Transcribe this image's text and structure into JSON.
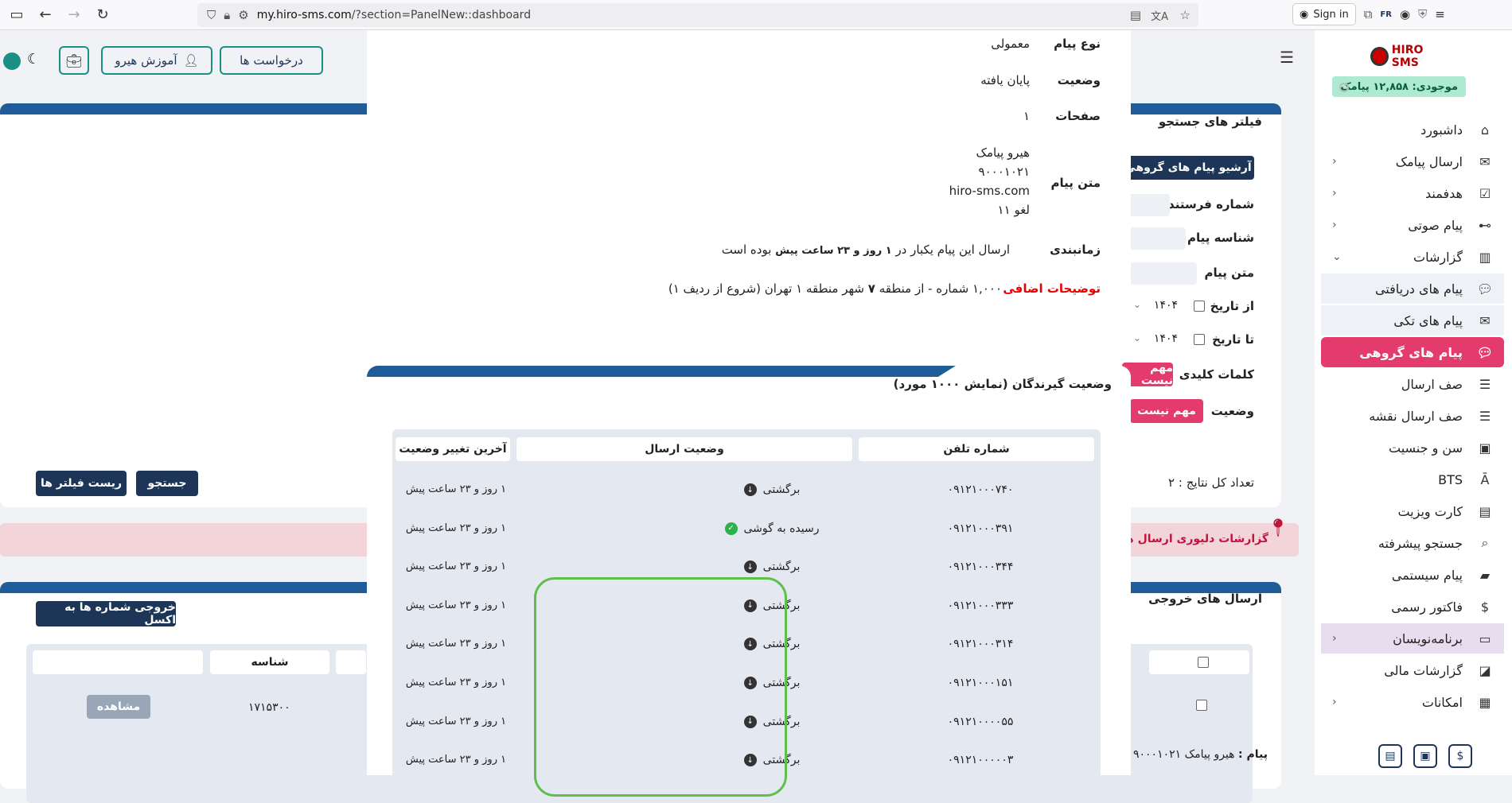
{
  "browser": {
    "url_host": "my.hiro-sms.com",
    "url_path": "/?section=PanelNew::dashboard",
    "signin_label": "Sign in",
    "flag_label": "FR"
  },
  "sidebar": {
    "logo_text": "HIRO SMS",
    "balance": "موجودی: ۱۲,۸۵۸ پیامک",
    "items": [
      {
        "label": "داشبورد",
        "icon": "home-icon"
      },
      {
        "label": "ارسال پیامک",
        "icon": "sms-icon"
      },
      {
        "label": "هدفمند",
        "icon": "target-icon"
      },
      {
        "label": "پیام صوتی",
        "icon": "voicemail-icon"
      },
      {
        "label": "گزارشات",
        "icon": "report-icon"
      },
      {
        "label": "پیام های دریافتی",
        "icon": "chat-icon"
      },
      {
        "label": "پیام های تکی",
        "icon": "sms-icon"
      },
      {
        "label": "پیام های گروهی",
        "icon": "group-chat-icon"
      },
      {
        "label": "صف ارسال",
        "icon": "queue-icon"
      },
      {
        "label": "صف ارسال نقشه",
        "icon": "queue-icon"
      },
      {
        "label": "سن و جنسیت",
        "icon": "id-card-icon"
      },
      {
        "label": "BTS",
        "icon": "antenna-icon"
      },
      {
        "label": "کارت ویزیت",
        "icon": "card-icon"
      },
      {
        "label": "جستجو پیشرفته",
        "icon": "search-icon"
      },
      {
        "label": "پیام سیستمی",
        "icon": "briefcase-icon"
      },
      {
        "label": "فاکتور رسمی",
        "icon": "invoice-icon"
      },
      {
        "label": "برنامه‌نویسان",
        "icon": "code-icon"
      },
      {
        "label": "گزارشات مالی",
        "icon": "chart-icon"
      },
      {
        "label": "امکانات",
        "icon": "tools-icon"
      }
    ]
  },
  "header": {
    "requests": "درخواست ها",
    "education": "آموزش هیرو"
  },
  "filters": {
    "title": "فیلتر های جستجو",
    "archive": "آرشیو پیام های گروهی",
    "sender": "شماره فرستنده",
    "msg_id": "شناسه پیام",
    "msg_text": "متن پیام",
    "from_date": "از تاریخ",
    "to_date": "تا تاریخ",
    "year": "۱۴۰۴",
    "keywords": "کلمات کلیدی",
    "status": "وضعیت",
    "not_important": "مهم نیست",
    "total": "تعداد کل نتایج : ۲",
    "search": "جستجو",
    "reset": "ریست فیلتر ها"
  },
  "alert": "گزارشات دلیوری ارسال ها تا پایا",
  "outbox": {
    "title": "ارسال های خروجی",
    "export": "خروجی شماره ها به اکسل",
    "col_id": "شناسه",
    "row_id": "۱۷۱۵۳۰۰",
    "view": "مشاهده",
    "message_label": "پیام :",
    "message_preview": "هیرو پیامک ۹۰۰۰۱۰۲۱"
  },
  "details": {
    "type_k": "نوع پیام",
    "type_v": "معمولی",
    "status_k": "وضعیت",
    "status_v": "پایان یافته",
    "pages_k": "صفحات",
    "pages_v": "۱",
    "text_k": "متن پیام",
    "text_l1": "هیرو پیامک",
    "text_l2": "۹۰۰۰۱۰۲۱",
    "text_l3": "hiro-sms.com",
    "text_l4": "لغو ۱۱",
    "sched_k": "زمانبندی",
    "sched_v1": "ارسال این پیام یکبار در",
    "sched_v2": "۱ روز و ۲۳ ساعت پیش",
    "sched_v3": "بوده است",
    "extra_k": "توضیحات اضافی",
    "extra_v1": "۱,۰۰۰ شماره - از منطقه",
    "extra_v2": "۷",
    "extra_v3": "شهر منطقه ۱ تهران (شروع از ردیف ۱)"
  },
  "recipients": {
    "title": "وضعیت گیرندگان (نمایش ۱۰۰۰ مورد)",
    "columns": [
      "شماره تلفن",
      "وضعیت ارسال",
      "آخرین تغییر وضعیت"
    ],
    "rows": [
      {
        "phone": "۰۹۱۲۱۰۰۰۷۴۰",
        "status": "برگشتی",
        "icon": "down-arrow-icon",
        "time": "۱ روز و ۲۳ ساعت پیش"
      },
      {
        "phone": "۰۹۱۲۱۰۰۰۳۹۱",
        "status": "رسیده به گوشی",
        "icon": "check-icon",
        "time": "۱ روز و ۲۳ ساعت پیش"
      },
      {
        "phone": "۰۹۱۲۱۰۰۰۳۴۴",
        "status": "برگشتی",
        "icon": "down-arrow-icon",
        "time": "۱ روز و ۲۳ ساعت پیش"
      },
      {
        "phone": "۰۹۱۲۱۰۰۰۳۳۳",
        "status": "برگشتی",
        "icon": "down-arrow-icon",
        "time": "۱ روز و ۲۳ ساعت پیش"
      },
      {
        "phone": "۰۹۱۲۱۰۰۰۳۱۴",
        "status": "برگشتی",
        "icon": "down-arrow-icon",
        "time": "۱ روز و ۲۳ ساعت پیش"
      },
      {
        "phone": "۰۹۱۲۱۰۰۰۱۵۱",
        "status": "برگشتی",
        "icon": "down-arrow-icon",
        "time": "۱ روز و ۲۳ ساعت پیش"
      },
      {
        "phone": "۰۹۱۲۱۰۰۰۰۵۵",
        "status": "برگشتی",
        "icon": "down-arrow-icon",
        "time": "۱ روز و ۲۳ ساعت پیش"
      },
      {
        "phone": "۰۹۱۲۱۰۰۰۰۰۳",
        "status": "برگشتی",
        "icon": "down-arrow-icon",
        "time": "۱ روز و ۲۳ ساعت پیش"
      }
    ]
  },
  "colors": {
    "accent": "#e33b6b",
    "primary": "#1d3557",
    "teal": "#1a8f86",
    "highlight": "#5fbf4a"
  }
}
